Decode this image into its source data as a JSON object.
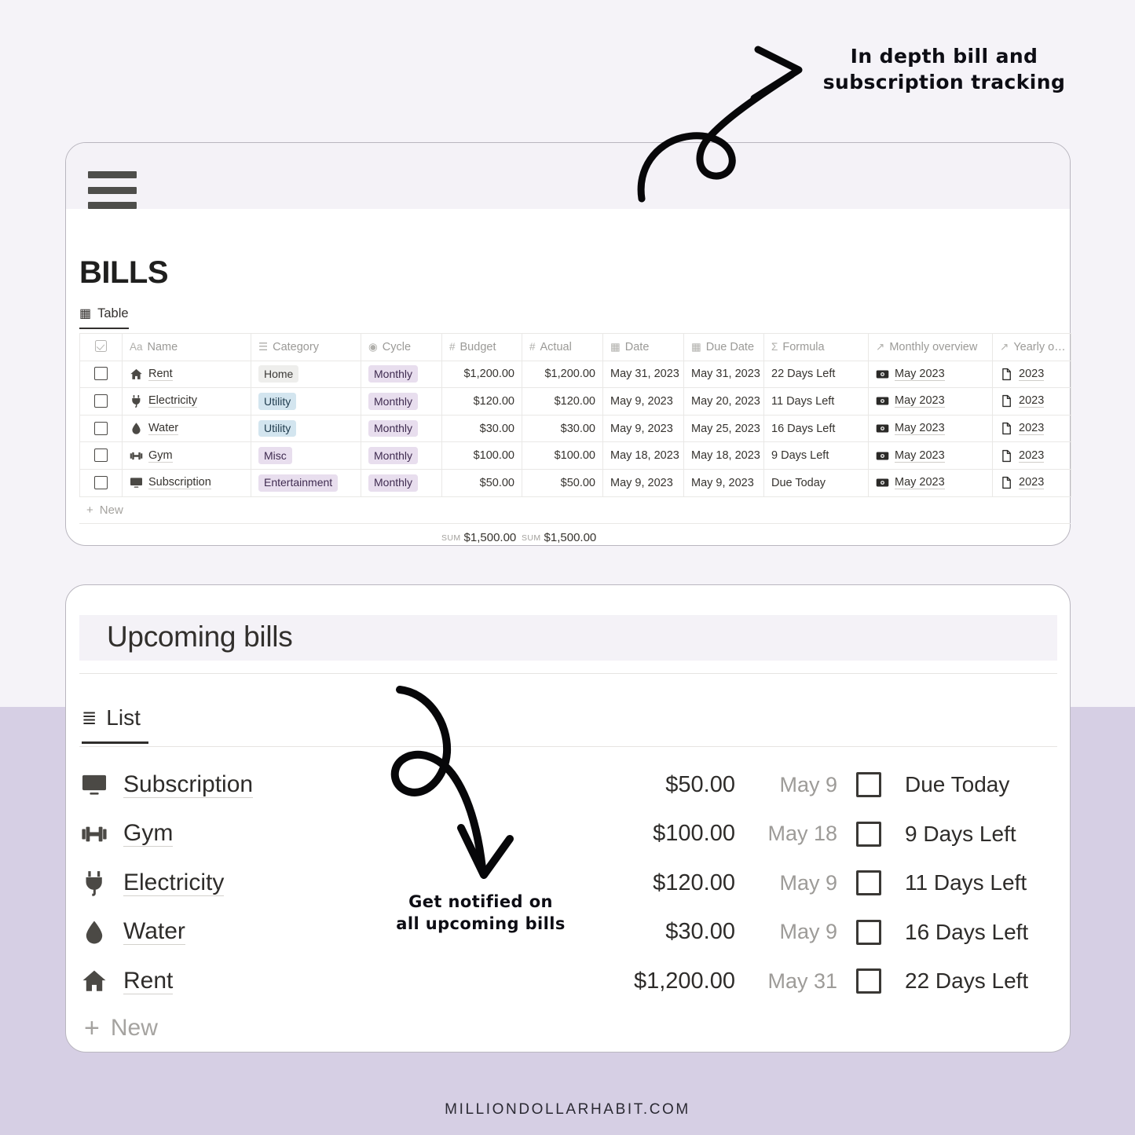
{
  "annotations": {
    "top": "In depth bill and\nsubscription tracking",
    "bottom": "Get notified on\nall upcoming bills"
  },
  "footer": {
    "text": "MILLIONDOLLARHABIT.COM"
  },
  "background": {
    "top_color": "#f5f3f8",
    "bottom_color": "#d6cfe4"
  },
  "bills_card": {
    "menu_icon": "hamburger-icon",
    "title": "BILLS",
    "view_tab": {
      "label": "Table",
      "icon": "table-icon"
    },
    "table": {
      "columns": [
        {
          "key": "check",
          "label": "",
          "icon": "checkbox-icon",
          "align": "left"
        },
        {
          "key": "name",
          "label": "Name",
          "icon": "Aa",
          "align": "left"
        },
        {
          "key": "category",
          "label": "Category",
          "icon": "select-icon",
          "align": "left"
        },
        {
          "key": "cycle",
          "label": "Cycle",
          "icon": "clock-icon",
          "align": "left"
        },
        {
          "key": "budget",
          "label": "Budget",
          "icon": "number-icon",
          "align": "right"
        },
        {
          "key": "actual",
          "label": "Actual",
          "icon": "number-icon",
          "align": "right"
        },
        {
          "key": "date",
          "label": "Date",
          "icon": "calendar-icon",
          "align": "left"
        },
        {
          "key": "duedate",
          "label": "Due Date",
          "icon": "calendar-icon",
          "align": "left"
        },
        {
          "key": "formula",
          "label": "Formula",
          "icon": "sigma-icon",
          "align": "left"
        },
        {
          "key": "monthly",
          "label": "Monthly overview",
          "icon": "relation-icon",
          "align": "left"
        },
        {
          "key": "yearly",
          "label": "Yearly o…",
          "icon": "relation-icon",
          "align": "left"
        }
      ],
      "rows": [
        {
          "icon": "house-icon",
          "name": "Rent",
          "category": "Home",
          "cat_color": "gray",
          "cycle": "Monthly",
          "budget": "$1,200.00",
          "actual": "$1,200.00",
          "date": "May 31, 2023",
          "duedate": "May 31, 2023",
          "formula": "22 Days Left",
          "monthly": "May 2023",
          "yearly": "2023"
        },
        {
          "icon": "plug-icon",
          "name": "Electricity",
          "category": "Utility",
          "cat_color": "blue",
          "cycle": "Monthly",
          "budget": "$120.00",
          "actual": "$120.00",
          "date": "May 9, 2023",
          "duedate": "May 20, 2023",
          "formula": "11 Days Left",
          "monthly": "May 2023",
          "yearly": "2023"
        },
        {
          "icon": "droplet-icon",
          "name": "Water",
          "category": "Utility",
          "cat_color": "blue",
          "cycle": "Monthly",
          "budget": "$30.00",
          "actual": "$30.00",
          "date": "May 9, 2023",
          "duedate": "May 25, 2023",
          "formula": "16 Days Left",
          "monthly": "May 2023",
          "yearly": "2023"
        },
        {
          "icon": "dumbbell-icon",
          "name": "Gym",
          "category": "Misc",
          "cat_color": "purple",
          "cycle": "Monthly",
          "budget": "$100.00",
          "actual": "$100.00",
          "date": "May 18, 2023",
          "duedate": "May 18, 2023",
          "formula": "9 Days Left",
          "monthly": "May 2023",
          "yearly": "2023"
        },
        {
          "icon": "monitor-icon",
          "name": "Subscription",
          "category": "Entertainment",
          "cat_color": "purple",
          "cycle": "Monthly",
          "budget": "$50.00",
          "actual": "$50.00",
          "date": "May 9, 2023",
          "duedate": "May 9, 2023",
          "formula": "Due Today",
          "monthly": "May 2023",
          "yearly": "2023"
        }
      ],
      "new_row_label": "New",
      "sums": [
        {
          "label": "SUM",
          "value": "$1,500.00"
        },
        {
          "label": "SUM",
          "value": "$1,500.00"
        }
      ]
    }
  },
  "upcoming_card": {
    "title": "Upcoming bills",
    "view_tab": {
      "label": "List",
      "icon": "list-icon"
    },
    "items": [
      {
        "icon": "monitor-icon",
        "name": "Subscription",
        "amount": "$50.00",
        "date": "May 9",
        "status": "Due Today"
      },
      {
        "icon": "dumbbell-icon",
        "name": "Gym",
        "amount": "$100.00",
        "date": "May 18",
        "status": "9 Days Left"
      },
      {
        "icon": "plug-icon",
        "name": "Electricity",
        "amount": "$120.00",
        "date": "May 9",
        "status": "11 Days Left"
      },
      {
        "icon": "droplet-icon",
        "name": "Water",
        "amount": "$30.00",
        "date": "May 9",
        "status": "16 Days Left"
      },
      {
        "icon": "house-icon",
        "name": "Rent",
        "amount": "$1,200.00",
        "date": "May 31",
        "status": "22 Days Left"
      }
    ],
    "new_row_label": "New"
  }
}
